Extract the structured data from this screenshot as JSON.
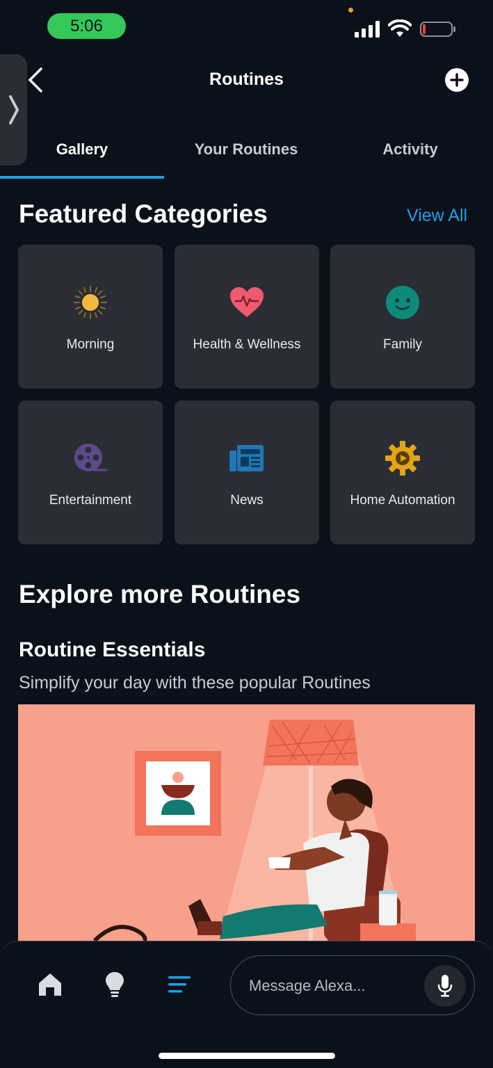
{
  "status_bar": {
    "time": "5:06"
  },
  "header": {
    "title": "Routines"
  },
  "tabs": [
    {
      "label": "Gallery",
      "active": true
    },
    {
      "label": "Your Routines",
      "active": false
    },
    {
      "label": "Activity",
      "active": false
    }
  ],
  "featured": {
    "title": "Featured Categories",
    "view_all": "View All",
    "categories": [
      {
        "label": "Morning",
        "icon": "sun-icon",
        "color": "#f5b942"
      },
      {
        "label": "Health & Wellness",
        "icon": "heart-pulse-icon",
        "color": "#ef5a6f"
      },
      {
        "label": "Family",
        "icon": "smiley-icon",
        "color": "#0e8a7a"
      },
      {
        "label": "Entertainment",
        "icon": "film-reel-icon",
        "color": "#5c4a8c"
      },
      {
        "label": "News",
        "icon": "newspaper-icon",
        "color": "#1f78b4"
      },
      {
        "label": "Home Automation",
        "icon": "gear-play-icon",
        "color": "#e2a516"
      }
    ]
  },
  "explore": {
    "title": "Explore more Routines",
    "essentials_title": "Routine Essentials",
    "essentials_subtitle": "Simplify your day with these popular Routines"
  },
  "bottom_nav": {
    "items": [
      "home-icon",
      "lightbulb-icon",
      "routines-list-icon"
    ],
    "message_placeholder": "Message Alexa..."
  },
  "colors": {
    "accent": "#1fa0e3",
    "background": "#0b111a",
    "tile": "#2a2d33"
  }
}
